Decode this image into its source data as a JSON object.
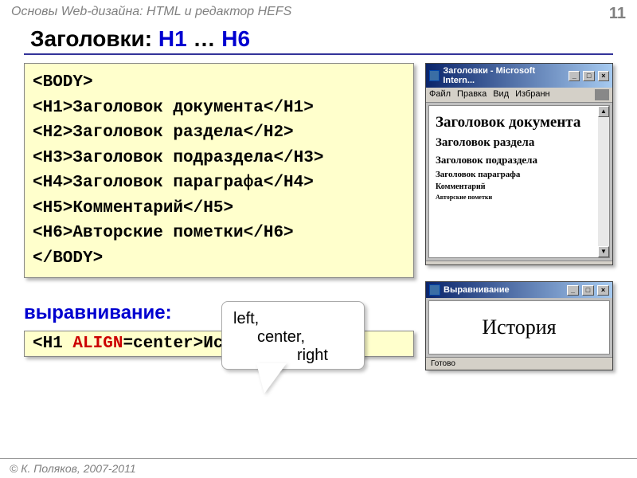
{
  "header": {
    "subject": "Основы Web-дизайна: HTML и редактор HEFS",
    "page_number": "11"
  },
  "title": {
    "prefix": "Заголовки: ",
    "h1": "H1",
    "ellipsis": " … ",
    "h6": "H6"
  },
  "code": {
    "l1": "<BODY>",
    "l2": "<H1>Заголовок документа</H1>",
    "l3": "<H2>Заголовок раздела</H2>",
    "l4": "<H3>Заголовок подраздела</H3>",
    "l5": "<H4>Заголовок параграфа</H4>",
    "l6": "<H5>Комментарий</H5>",
    "l7": "<H6>Авторские пометки</H6>",
    "l8": "</BODY>"
  },
  "alignment": {
    "label": "выравнивание:",
    "callout_l1": "left,",
    "callout_l2": "center,",
    "callout_l3": "right",
    "code_open": "<H1 ",
    "code_attr": "ALIGN",
    "code_rest": "=center>История</H1>"
  },
  "browser1": {
    "title": "Заголовки - Microsoft Intern...",
    "menu": {
      "file": "Файл",
      "edit": "Правка",
      "view": "Вид",
      "fav": "Избранн"
    },
    "h1": "Заголовок документа",
    "h2": "Заголовок раздела",
    "h3": "Заголовок подраздела",
    "h4": "Заголовок параграфа",
    "h5": "Комментарий",
    "h6": "Авторские пометки",
    "status": ""
  },
  "browser2": {
    "title": "Выравнивание",
    "content": "История",
    "status": "Готово"
  },
  "footer": "© К. Поляков, 2007-2011"
}
